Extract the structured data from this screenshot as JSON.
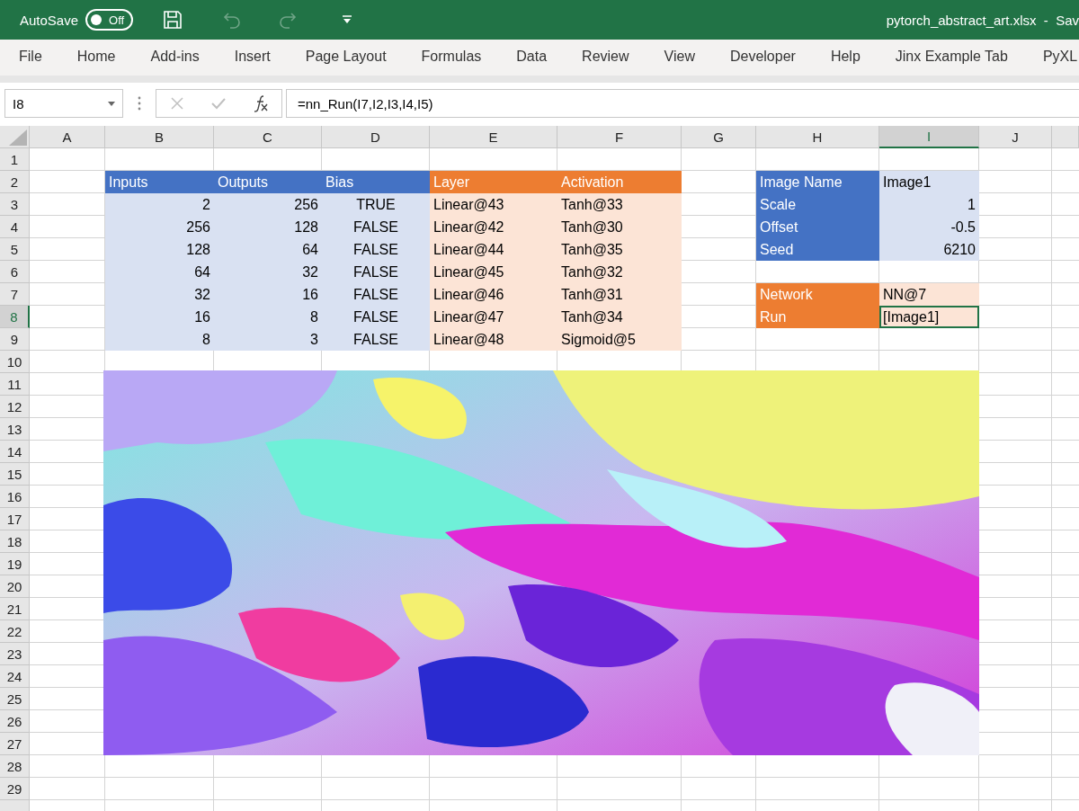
{
  "title_bar": {
    "autosave": {
      "label": "AutoSave",
      "on": false,
      "state_text": "Off"
    },
    "quick_access": [
      {
        "kind": "save",
        "disabled": false
      },
      {
        "kind": "undo",
        "disabled": true
      },
      {
        "kind": "redo",
        "disabled": true
      },
      {
        "kind": "customize",
        "disabled": false
      }
    ],
    "title": "pytorch_abstract_art.xlsx  -  Sav"
  },
  "ribbon_tabs": [
    {
      "label": "File",
      "selected": false
    },
    {
      "label": "Home",
      "selected": false
    },
    {
      "label": "Add-ins",
      "selected": false
    },
    {
      "label": "Insert",
      "selected": false
    },
    {
      "label": "Page Layout",
      "selected": false
    },
    {
      "label": "Formulas",
      "selected": false
    },
    {
      "label": "Data",
      "selected": false
    },
    {
      "label": "Review",
      "selected": false
    },
    {
      "label": "View",
      "selected": false
    },
    {
      "label": "Developer",
      "selected": false
    },
    {
      "label": "Help",
      "selected": false
    },
    {
      "label": "Jinx Example Tab",
      "selected": false
    },
    {
      "label": "PyXL",
      "selected": false
    }
  ],
  "formula_bar": {
    "name_box": "I8",
    "buttons": [
      {
        "kind": "cancel",
        "disabled": true
      },
      {
        "kind": "enter",
        "disabled": true
      },
      {
        "kind": "function",
        "disabled": false
      }
    ],
    "formula": "=nn_Run(I7,I2,I3,I4,I5)"
  },
  "grid": {
    "columns": [
      {
        "label": "A",
        "selected": false
      },
      {
        "label": "B",
        "selected": false
      },
      {
        "label": "C",
        "selected": false
      },
      {
        "label": "D",
        "selected": false
      },
      {
        "label": "E",
        "selected": false
      },
      {
        "label": "F",
        "selected": false
      },
      {
        "label": "G",
        "selected": false
      },
      {
        "label": "H",
        "selected": false
      },
      {
        "label": "I",
        "selected": true
      },
      {
        "label": "J",
        "selected": false
      }
    ],
    "row_numbers": [
      {
        "number": "1",
        "selected": false
      },
      {
        "number": "2",
        "selected": false
      },
      {
        "number": "3",
        "selected": false
      },
      {
        "number": "4",
        "selected": false
      },
      {
        "number": "5",
        "selected": false
      },
      {
        "number": "6",
        "selected": false
      },
      {
        "number": "7",
        "selected": false
      },
      {
        "number": "8",
        "selected": true
      },
      {
        "number": "9",
        "selected": false
      },
      {
        "number": "10",
        "selected": false
      },
      {
        "number": "11",
        "selected": false
      },
      {
        "number": "12",
        "selected": false
      },
      {
        "number": "13",
        "selected": false
      },
      {
        "number": "14",
        "selected": false
      },
      {
        "number": "15",
        "selected": false
      },
      {
        "number": "16",
        "selected": false
      },
      {
        "number": "17",
        "selected": false
      },
      {
        "number": "18",
        "selected": false
      },
      {
        "number": "19",
        "selected": false
      },
      {
        "number": "20",
        "selected": false
      },
      {
        "number": "21",
        "selected": false
      },
      {
        "number": "22",
        "selected": false
      },
      {
        "number": "23",
        "selected": false
      },
      {
        "number": "24",
        "selected": false
      },
      {
        "number": "25",
        "selected": false
      },
      {
        "number": "26",
        "selected": false
      },
      {
        "number": "27",
        "selected": false
      },
      {
        "number": "28",
        "selected": false
      },
      {
        "number": "29",
        "selected": false
      }
    ],
    "layers_table": {
      "header": [
        "Inputs",
        "Outputs",
        "Bias",
        "Layer",
        "Activation"
      ],
      "rows": [
        [
          "2",
          "256",
          "TRUE",
          "Linear@43",
          "Tanh@33"
        ],
        [
          "256",
          "128",
          "FALSE",
          "Linear@42",
          "Tanh@30"
        ],
        [
          "128",
          "64",
          "FALSE",
          "Linear@44",
          "Tanh@35"
        ],
        [
          "64",
          "32",
          "FALSE",
          "Linear@45",
          "Tanh@32"
        ],
        [
          "32",
          "16",
          "FALSE",
          "Linear@46",
          "Tanh@31"
        ],
        [
          "16",
          "8",
          "FALSE",
          "Linear@47",
          "Tanh@34"
        ],
        [
          "8",
          "3",
          "FALSE",
          "Linear@48",
          "Sigmoid@5"
        ]
      ]
    },
    "image_params": [
      {
        "label": "Image Name",
        "value": "Image1",
        "kind": "text",
        "selected": false
      },
      {
        "label": "Scale",
        "value": "1",
        "kind": "number",
        "selected": false
      },
      {
        "label": "Offset",
        "value": "-0.5",
        "kind": "number",
        "selected": false
      },
      {
        "label": "Seed",
        "value": "6210",
        "kind": "number",
        "selected": false
      }
    ],
    "network_params": [
      {
        "label": "Network",
        "value": "NN@7",
        "selected": false
      },
      {
        "label": "Run",
        "value": "[Image1]",
        "selected": true
      }
    ]
  }
}
